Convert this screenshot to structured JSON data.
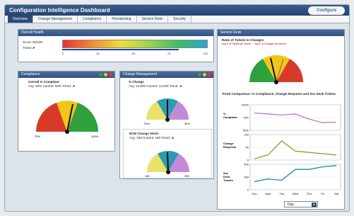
{
  "app": {
    "title": "Configuration Intelligence Dashboard",
    "brand": "Configure"
  },
  "tabs": [
    {
      "label": "Overview"
    },
    {
      "label": "Change Management"
    },
    {
      "label": "Compliance"
    },
    {
      "label": "Provisioning"
    },
    {
      "label": "Service Desk"
    },
    {
      "label": "Security"
    }
  ],
  "overall_health": {
    "title": "Overall Health",
    "score_label": "Score:",
    "score_value": "80/100",
    "trend_label": "Trend:",
    "scale": [
      "0",
      "25",
      "50",
      "75",
      "100"
    ]
  },
  "compliance": {
    "title": "Compliance",
    "metric": "Overall % Compliant",
    "avg_label": "Avg:",
    "avg_value": "92%",
    "current_label": "Current:",
    "current_value": "94%",
    "trend_label": "Trend:",
    "min": "75%",
    "max": "100%"
  },
  "change_mgmt": {
    "title": "Change Management",
    "pct_title": "% Change",
    "pct_avg_label": "Avg:",
    "pct_avg_value": "13,500",
    "pct_current_label": "Current:",
    "pct_current_value": "14,200",
    "pct_trend_label": "Trend:",
    "pct_min": "20%",
    "pct_max": "30%",
    "ecm_title": "ECM Change Alerts",
    "ecm_avg_label": "Avg:",
    "ecm_avg_value": "230",
    "ecm_current_label": "Current:",
    "ecm_current_value": "160",
    "ecm_trend_label": "Trend:",
    "ecm_min": "150",
    "ecm_max": "250"
  },
  "service_desk": {
    "title": "Service Desk",
    "ratio_title": "Ratio of Tickets to Changes",
    "legend_left": "Avg # of Tickets per Month",
    "legend_right": "Avg # of Changes per Month",
    "trend_title": "Trend Comparison: % Compliance, Change Requests and Svc Desk Tickets",
    "days": [
      "Sun",
      "Mon",
      "Tue",
      "Wed",
      "Thu",
      "Fri",
      "Sat"
    ],
    "period_select": "Day",
    "chart_data": [
      {
        "type": "line",
        "title": "% Compliant",
        "ylim": [
          50,
          100
        ],
        "ticks": [
          "100%",
          "75%",
          "50%"
        ],
        "x": [
          "Sun",
          "Mon",
          "Tue",
          "Wed",
          "Thu",
          "Fri",
          "Sat"
        ],
        "values": [
          84,
          82,
          80,
          82,
          72,
          65,
          66
        ],
        "color": "#b57ac8"
      },
      {
        "type": "line",
        "title": "Change Requests",
        "ylim": [
          0,
          100
        ],
        "ticks": [
          "100",
          "50",
          "0"
        ],
        "x": [
          "Sun",
          "Mon",
          "Tue",
          "Wed",
          "Thu",
          "Fri",
          "Sat"
        ],
        "values": [
          5,
          20,
          75,
          35,
          30,
          25,
          20
        ],
        "color": "#86a12c"
      },
      {
        "type": "line",
        "title": "Svc Desk Tickets",
        "ylim": [
          0,
          400
        ],
        "ticks": [
          "400",
          "200",
          "0"
        ],
        "x": [
          "Sun",
          "Mon",
          "Tue",
          "Wed",
          "Thu",
          "Fri",
          "Sat"
        ],
        "values": [
          130,
          170,
          150,
          320,
          320,
          360,
          380
        ],
        "color": "#1c8a9a"
      }
    ]
  },
  "colors": {
    "accent": "#2a4a78",
    "green": "#2da23c",
    "yellow": "#f0c619",
    "red": "#d83a2a",
    "teal": "#2b9caf",
    "purple": "#c48ad8",
    "lime": "#9ab53a"
  }
}
